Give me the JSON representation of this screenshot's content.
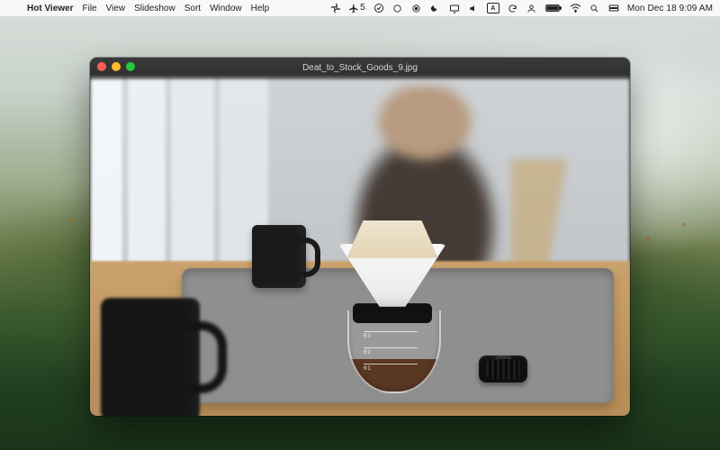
{
  "menubar": {
    "app_name": "Hot Viewer",
    "menus": [
      "File",
      "View",
      "Slideshow",
      "Sort",
      "Window",
      "Help"
    ],
    "status": {
      "flight_count": "5",
      "datetime": "Mon Dec 18  9:09 AM"
    }
  },
  "window": {
    "title": "Deat_to_Stock_Goods_9.jpg"
  },
  "photo": {
    "carafe_ticks": [
      "03",
      "02",
      "01"
    ]
  }
}
